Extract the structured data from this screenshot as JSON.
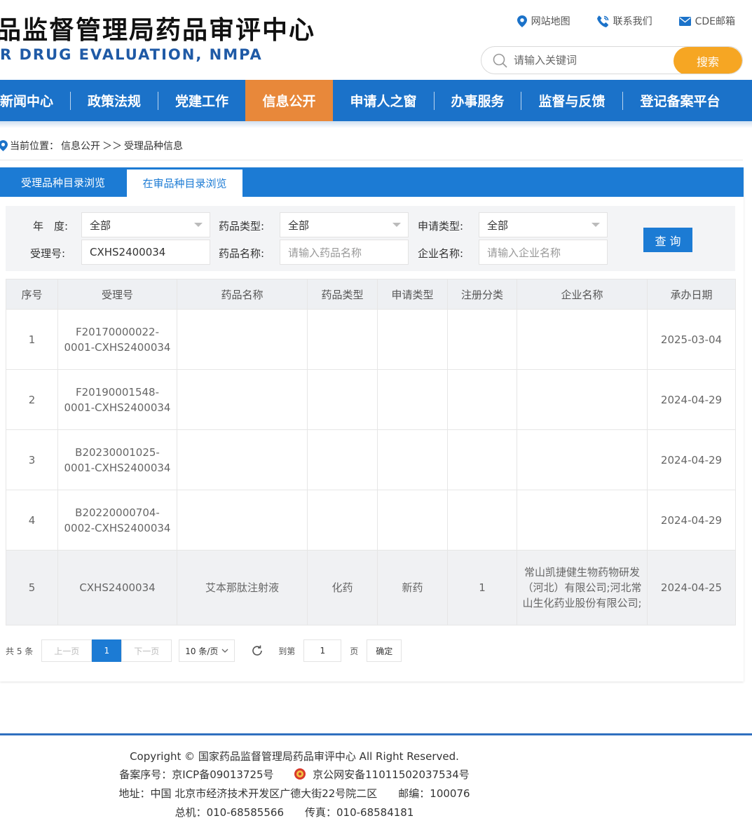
{
  "header": {
    "site_title_cn": "品监督管理局药品审评中心",
    "site_title_en": "R DRUG EVALUATION, NMPA",
    "links": [
      "网站地图",
      "联系我们",
      "CDE邮箱"
    ],
    "search_placeholder": "请输入关键词",
    "search_button": "搜索"
  },
  "nav": {
    "items": [
      "新闻中心",
      "政策法规",
      "党建工作",
      "信息公开",
      "申请人之窗",
      "办事服务",
      "监督与反馈",
      "登记备案平台"
    ],
    "active": "信息公开"
  },
  "breadcrumb": {
    "label": "当前位置：",
    "path1": "信息公开",
    "sep": "＞＞",
    "path2": "受理品种信息"
  },
  "tabs": [
    "受理品种目录浏览",
    "在审品种目录浏览"
  ],
  "filter": {
    "year_label": "年　度:",
    "year_value": "全部",
    "drug_type_label": "药品类型:",
    "drug_type_value": "全部",
    "apply_type_label": "申请类型:",
    "apply_type_value": "全部",
    "accept_no_label": "受理号:",
    "accept_no_value": "CXHS2400034",
    "drug_name_label": "药品名称:",
    "drug_name_placeholder": "请输入药品名称",
    "company_label": "企业名称:",
    "company_placeholder": "请输入企业名称",
    "query_button": "查 询"
  },
  "table": {
    "headers": [
      "序号",
      "受理号",
      "药品名称",
      "药品类型",
      "申请类型",
      "注册分类",
      "企业名称",
      "承办日期"
    ],
    "rows": [
      {
        "no": "1",
        "accept_no": "F20170000022-0001-CXHS2400034",
        "drug_name": "",
        "drug_type": "",
        "apply_type": "",
        "reg_class": "",
        "company": "",
        "date": "2025-03-04"
      },
      {
        "no": "2",
        "accept_no": "F20190001548-0001-CXHS2400034",
        "drug_name": "",
        "drug_type": "",
        "apply_type": "",
        "reg_class": "",
        "company": "",
        "date": "2024-04-29"
      },
      {
        "no": "3",
        "accept_no": "B20230001025-0001-CXHS2400034",
        "drug_name": "",
        "drug_type": "",
        "apply_type": "",
        "reg_class": "",
        "company": "",
        "date": "2024-04-29"
      },
      {
        "no": "4",
        "accept_no": "B20220000704-0002-CXHS2400034",
        "drug_name": "",
        "drug_type": "",
        "apply_type": "",
        "reg_class": "",
        "company": "",
        "date": "2024-04-29"
      },
      {
        "no": "5",
        "accept_no": "CXHS2400034",
        "drug_name": "艾本那肽注射液",
        "drug_type": "化药",
        "apply_type": "新药",
        "reg_class": "1",
        "company": "常山凯捷健生物药物研发（河北）有限公司;河北常山生化药业股份有限公司;",
        "date": "2024-04-25"
      }
    ]
  },
  "pager": {
    "total": "共 5 条",
    "prev": "上一页",
    "current": "1",
    "next": "下一页",
    "page_size": "10 条/页",
    "goto_label": "到第",
    "goto_value": "1",
    "page_unit": "页",
    "confirm": "确定"
  },
  "footer": {
    "copyright": "Copyright © 国家药品监督管理局药品审评中心   All Right Reserved.",
    "icp": "备案序号：京ICP备09013725号",
    "police": "京公网安备11011502037534号",
    "address": "地址：中国 北京市经济技术开发区广德大街22号院二区　　邮编：100076",
    "phone": "总机：010-68585566　　传真：010-68584181"
  },
  "colors": {
    "nav_blue": "#1b72c9",
    "nav_active": "#e8883a",
    "search_button": "#f6a623",
    "tab_blue": "#1c7bd4",
    "title_en": "#1f5aa6"
  }
}
